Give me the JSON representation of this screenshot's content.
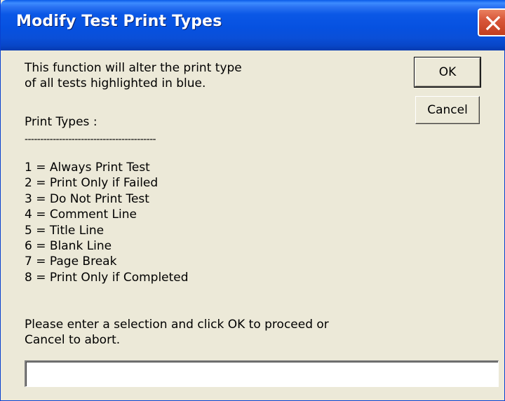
{
  "window": {
    "title": "Modify Test Print Types",
    "close_icon": "close-icon"
  },
  "message": {
    "line1": "This function will alter the print type",
    "line2": "of all tests highlighted in blue.",
    "print_types_heading": "Print Types :",
    "separator": "------------------------------------------",
    "instruction_line1": "Please enter a selection and click OK to proceed or",
    "instruction_line2": "Cancel to abort."
  },
  "print_types": [
    "1 = Always Print Test",
    "2 = Print Only if Failed",
    "3 = Do Not Print Test",
    "4 = Comment Line",
    "5 = Title Line",
    "6 = Blank Line",
    "7 = Page Break",
    "8 = Print Only if Completed"
  ],
  "buttons": {
    "ok": "OK",
    "cancel": "Cancel"
  },
  "input": {
    "value": ""
  }
}
